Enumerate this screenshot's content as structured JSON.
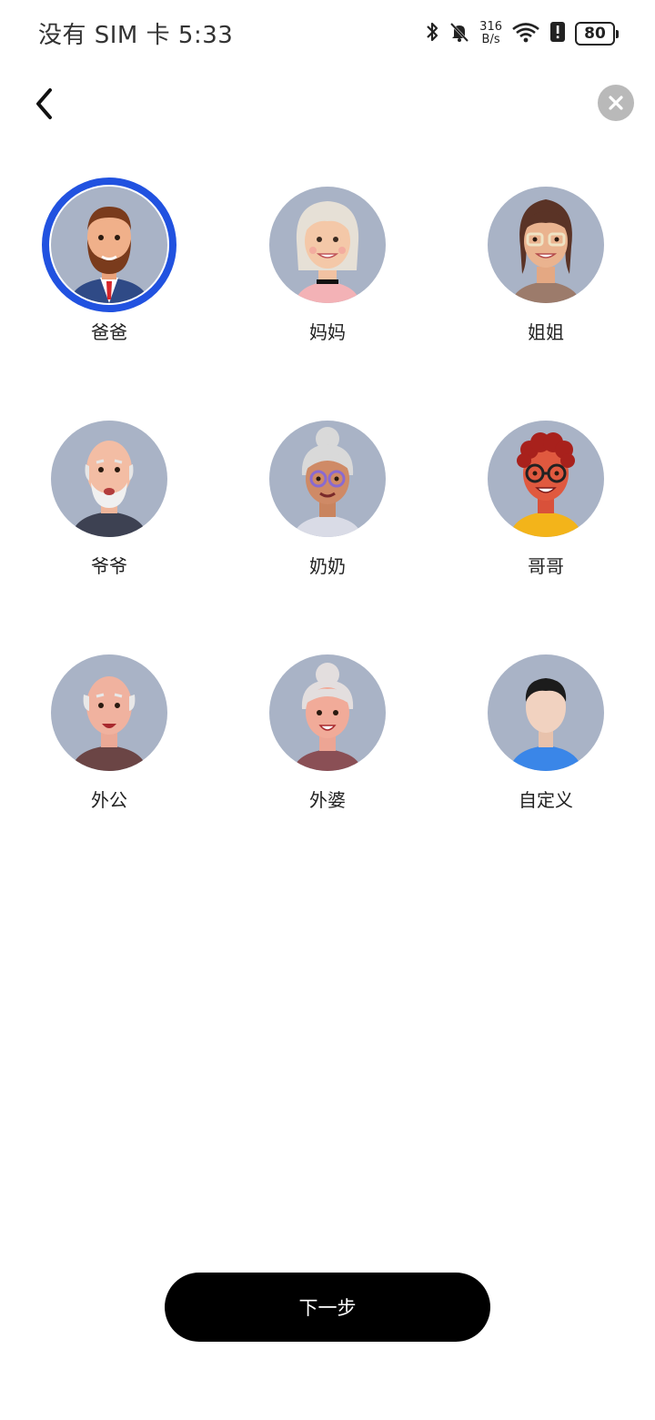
{
  "status_bar": {
    "carrier_time": "没有 SIM 卡 5:33",
    "net_speed_value": "316",
    "net_speed_unit": "B/s",
    "battery": "80"
  },
  "avatars": [
    {
      "label": "爸爸",
      "selected": true
    },
    {
      "label": "妈妈",
      "selected": false
    },
    {
      "label": "姐姐",
      "selected": false
    },
    {
      "label": "爷爷",
      "selected": false
    },
    {
      "label": "奶奶",
      "selected": false
    },
    {
      "label": "哥哥",
      "selected": false
    },
    {
      "label": "外公",
      "selected": false
    },
    {
      "label": "外婆",
      "selected": false
    },
    {
      "label": "自定义",
      "selected": false
    }
  ],
  "next_button": {
    "label": "下一步"
  },
  "colors": {
    "selected_ring": "#2152e0",
    "avatar_bg": "#a9b3c6",
    "button_bg": "#000000"
  }
}
